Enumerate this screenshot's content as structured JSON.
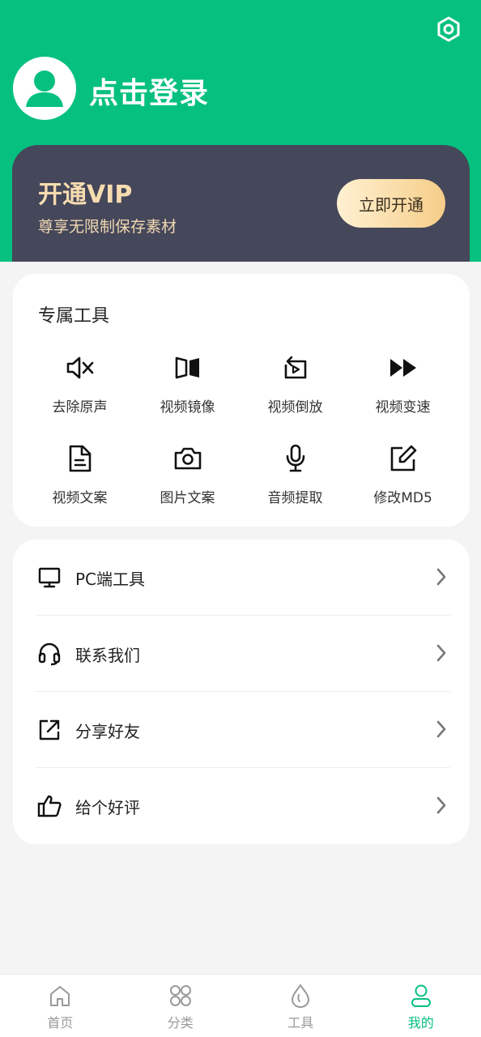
{
  "header": {
    "login_text": "点击登录",
    "settings_icon": "hexagon-settings-icon",
    "avatar_icon": "user-avatar-icon"
  },
  "vip": {
    "title": "开通VIP",
    "subtitle": "尊享无限制保存素材",
    "button_label": "立即开通"
  },
  "tools": {
    "title": "专属工具",
    "items": [
      {
        "label": "去除原声",
        "icon": "mute-icon"
      },
      {
        "label": "视频镜像",
        "icon": "mirror-icon"
      },
      {
        "label": "视频倒放",
        "icon": "rewind-play-icon"
      },
      {
        "label": "视频变速",
        "icon": "fast-forward-icon"
      },
      {
        "label": "视频文案",
        "icon": "document-icon"
      },
      {
        "label": "图片文案",
        "icon": "camera-icon"
      },
      {
        "label": "音频提取",
        "icon": "microphone-icon"
      },
      {
        "label": "修改MD5",
        "icon": "edit-icon"
      }
    ]
  },
  "menu": {
    "items": [
      {
        "label": "PC端工具",
        "icon": "monitor-icon"
      },
      {
        "label": "联系我们",
        "icon": "headset-icon"
      },
      {
        "label": "分享好友",
        "icon": "share-icon"
      },
      {
        "label": "给个好评",
        "icon": "thumbs-up-icon"
      }
    ]
  },
  "tabbar": {
    "items": [
      {
        "label": "首页",
        "icon": "home-icon",
        "active": false
      },
      {
        "label": "分类",
        "icon": "grid-icon",
        "active": false
      },
      {
        "label": "工具",
        "icon": "drop-icon",
        "active": false
      },
      {
        "label": "我的",
        "icon": "profile-icon",
        "active": true
      }
    ]
  },
  "colors": {
    "primary": "#05c07e",
    "vip_bg": "#45475a",
    "vip_text": "#f7dcb0",
    "background": "#f4f4f4"
  }
}
